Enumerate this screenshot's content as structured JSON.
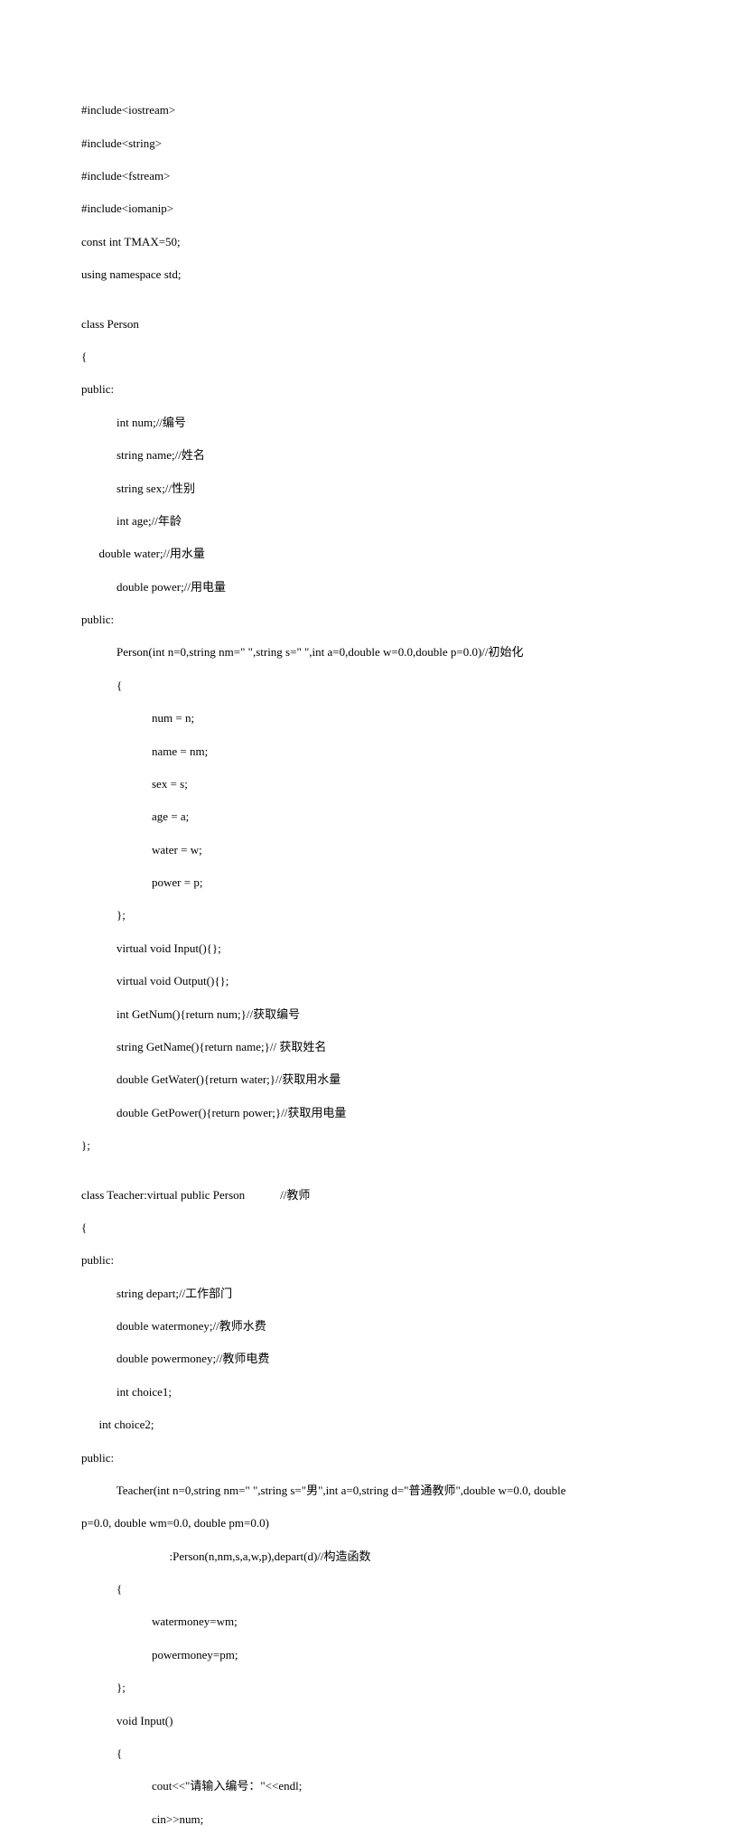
{
  "code": {
    "l01": "#include<iostream>",
    "l02": "#include<string>",
    "l03": "#include<fstream>",
    "l04": "#include<iomanip>",
    "l05": "const int TMAX=50;",
    "l06": "using namespace std;",
    "l07": "",
    "l08": "class Person",
    "l09": "{",
    "l10": "public:",
    "l11": "            int num;//编号",
    "l12": "            string name;//姓名",
    "l13": "            string sex;//性别",
    "l14": "            int age;//年龄",
    "l15": "      double water;//用水量",
    "l16": "            double power;//用电量",
    "l17": "public:",
    "l18": "            Person(int n=0,string nm=\" \",string s=\" \",int a=0,double w=0.0,double p=0.0)//初始化",
    "l19": "            {",
    "l20": "                        num = n;",
    "l21": "                        name = nm;",
    "l22": "                        sex = s;",
    "l23": "                        age = a;",
    "l24": "                        water = w;",
    "l25": "                        power = p;",
    "l26": "            };",
    "l27": "            virtual void Input(){};",
    "l28": "            virtual void Output(){};",
    "l29": "            int GetNum(){return num;}//获取编号",
    "l30": "            string GetName(){return name;}// 获取姓名",
    "l31": "            double GetWater(){return water;}//获取用水量",
    "l32": "            double GetPower(){return power;}//获取用电量",
    "l33": "};",
    "l34": "",
    "l35": "class Teacher:virtual public Person            //教师",
    "l36": "{",
    "l37": "public:",
    "l38": "            string depart;//工作部门",
    "l39": "            double watermoney;//教师水费",
    "l40": "            double powermoney;//教师电费",
    "l41": "            int choice1;",
    "l42": "      int choice2;",
    "l43": "public:",
    "l44": "            Teacher(int n=0,string nm=\" \",string s=\"男\",int a=0,string d=\"普通教师\",double w=0.0, double",
    "l45": "p=0.0, double wm=0.0, double pm=0.0)",
    "l46": "                              :Person(n,nm,s,a,w,p),depart(d)//构造函数",
    "l47": "            {",
    "l48": "                        watermoney=wm;",
    "l49": "                        powermoney=pm;",
    "l50": "            };",
    "l51": "            void Input()",
    "l52": "            {",
    "l53": "                        cout<<\"请输入编号：\"<<endl;",
    "l54": "                        cin>>num;"
  }
}
